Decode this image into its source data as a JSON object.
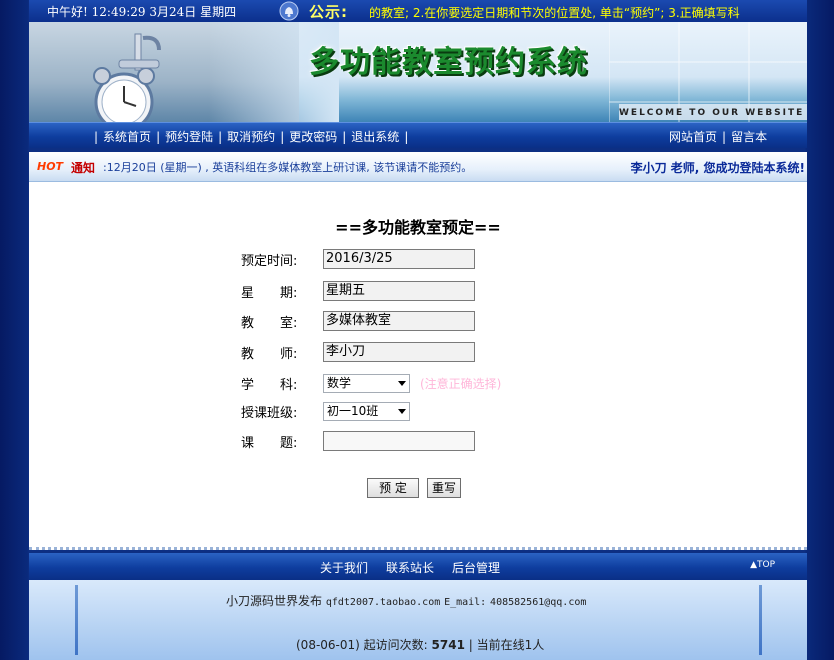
{
  "topbar": {
    "greeting": "中午好! 12:49:29 3月24日 星期四",
    "announcement_label": "公示:",
    "announcement_text": "的教室; 2.在你要选定日期和节次的位置处, 单击“预约”; 3.正确填写科"
  },
  "banner": {
    "title": "多功能教室预约系统",
    "welcome": "WELCOME TO OUR WEBSITE"
  },
  "nav": {
    "left": [
      "系统首页",
      "预约登陆",
      "取消预约",
      "更改密码",
      "退出系统"
    ],
    "right": [
      "网站首页",
      "留言本"
    ]
  },
  "notice": {
    "hot": "HOT",
    "label": "通知",
    "text": ":12月20日 (星期一) , 英语科组在多媒体教室上研讨课, 该节课请不能预约。",
    "welcome_user": "李小刀 老师, 您成功登陆本系统!"
  },
  "form": {
    "title": "==多功能教室预定==",
    "fields": {
      "date": {
        "label": "预定时间:",
        "value": "2016/3/25"
      },
      "weekday": {
        "label": "星　　期:",
        "value": "星期五"
      },
      "room": {
        "label": "教　　室:",
        "value": "多媒体教室"
      },
      "teacher": {
        "label": "教　　师:",
        "value": "李小刀"
      },
      "subject": {
        "label": "学　　科:",
        "value": "数学",
        "hint": "(注意正确选择)"
      },
      "class": {
        "label": "授课班级:",
        "value": "初一10班"
      },
      "topic": {
        "label": "课　　题:",
        "value": ""
      }
    },
    "submit_label": "预 定",
    "reset_label": "重写"
  },
  "bottom_nav": {
    "links": [
      "关于我们",
      "联系站长",
      "后台管理"
    ],
    "top_label": "▲TOP"
  },
  "footer": {
    "publisher": "小刀源码世界发布",
    "site": "qfdt2007.taobao.com",
    "email_label": "E_mail:",
    "email": "408582561@qq.com",
    "stats_prefix": "(08-06-01) 起访问次数:",
    "visits": "5741",
    "online": "| 当前在线1人"
  }
}
